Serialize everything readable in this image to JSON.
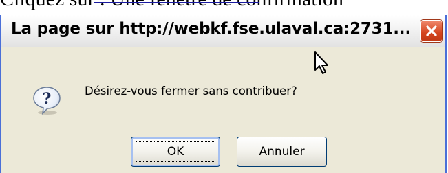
{
  "background": {
    "text": "Cliquez sur                          . Une fenêtre de confirmation"
  },
  "dialog": {
    "title": "La page sur http://webkf.fse.ulaval.ca:2731...",
    "message": "Désirez-vous fermer sans contribuer?",
    "icon": "question-icon",
    "buttons": {
      "ok_label": "OK",
      "cancel_label": "Annuler"
    }
  },
  "colors": {
    "dialog_bg": "#ece9d8",
    "close_red": "#d4451f",
    "button_border": "#003c74",
    "window_border": "#4a6fd8"
  }
}
